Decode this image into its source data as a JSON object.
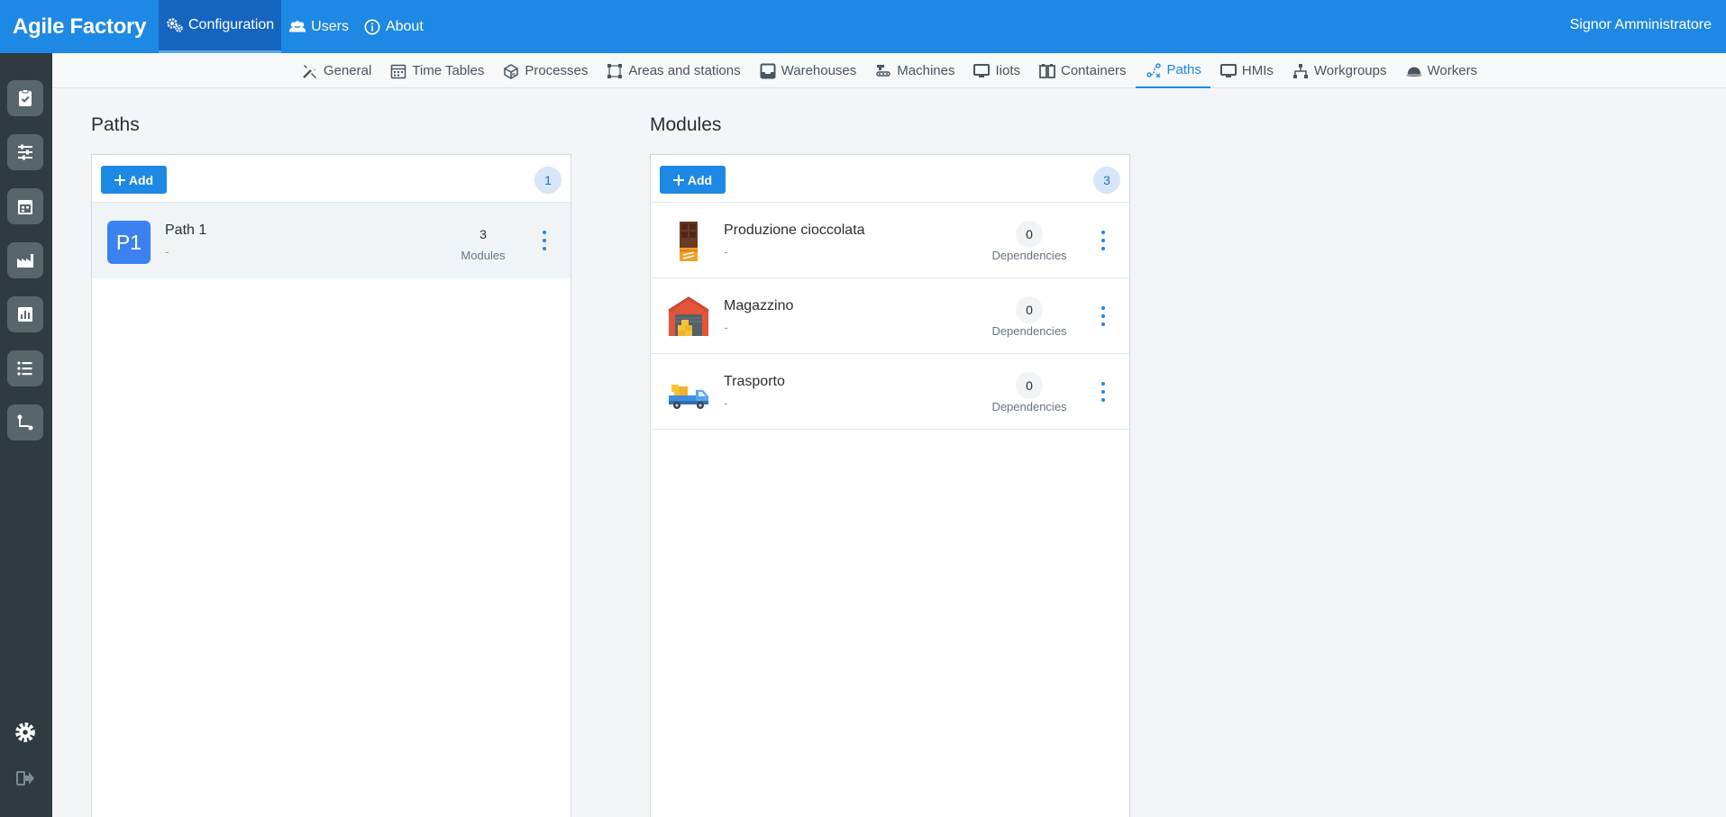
{
  "app": {
    "title": "Agile Factory",
    "user": "Signor Amministratore"
  },
  "topnav": [
    {
      "label": "Configuration",
      "icon": "gears-icon",
      "active": true
    },
    {
      "label": "Users",
      "icon": "users-icon",
      "active": false
    },
    {
      "label": "About",
      "icon": "info-icon",
      "active": false
    }
  ],
  "subtabs": [
    {
      "label": "General",
      "icon": "tools-icon"
    },
    {
      "label": "Time Tables",
      "icon": "calendar-icon"
    },
    {
      "label": "Processes",
      "icon": "processes-icon"
    },
    {
      "label": "Areas and stations",
      "icon": "area-icon"
    },
    {
      "label": "Warehouses",
      "icon": "warehouse-icon"
    },
    {
      "label": "Machines",
      "icon": "machine-icon"
    },
    {
      "label": "Iiots",
      "icon": "monitor-icon"
    },
    {
      "label": "Containers",
      "icon": "containers-icon"
    },
    {
      "label": "Paths",
      "icon": "paths-icon",
      "active": true
    },
    {
      "label": "HMIs",
      "icon": "monitor-icon"
    },
    {
      "label": "Workgroups",
      "icon": "workgroups-icon"
    },
    {
      "label": "Workers",
      "icon": "helmet-icon"
    }
  ],
  "paths": {
    "title": "Paths",
    "add_label": "Add",
    "count": "1",
    "items": [
      {
        "initials": "P1",
        "name": "Path 1",
        "subtitle": "-",
        "stat_value": "3",
        "stat_label": "Modules"
      }
    ]
  },
  "modules": {
    "title": "Modules",
    "add_label": "Add",
    "count": "3",
    "items": [
      {
        "name": "Produzione cioccolata",
        "subtitle": "-",
        "stat_value": "0",
        "stat_label": "Dependencies",
        "icon": "chocolate-icon"
      },
      {
        "name": "Magazzino",
        "subtitle": "-",
        "stat_value": "0",
        "stat_label": "Dependencies",
        "icon": "warehouse-building-icon"
      },
      {
        "name": "Trasporto",
        "subtitle": "-",
        "stat_value": "0",
        "stat_label": "Dependencies",
        "icon": "truck-icon"
      }
    ]
  },
  "colors": {
    "primary": "#1e88e5",
    "sidebar": "#2f3b40",
    "active_nav": "#1565c0"
  }
}
